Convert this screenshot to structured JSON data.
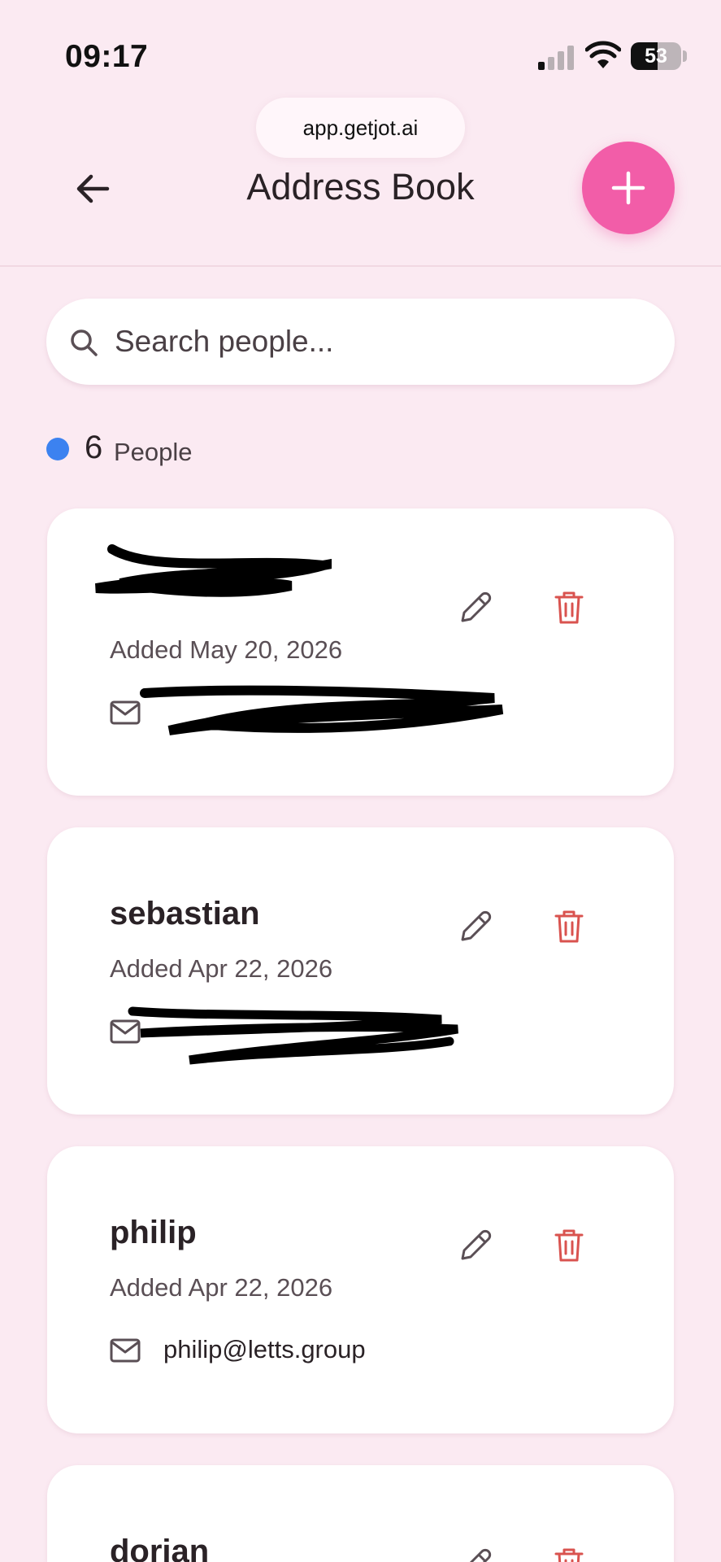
{
  "status_bar": {
    "time": "09:17",
    "battery": "53",
    "battery_level": 0.53
  },
  "browser": {
    "url": "app.getjot.ai"
  },
  "header": {
    "title": "Address Book"
  },
  "search": {
    "placeholder": "Search people..."
  },
  "summary": {
    "count": "6",
    "label": "People"
  },
  "contacts": [
    {
      "name": "",
      "added": "Added May 20, 2026",
      "email": ""
    },
    {
      "name": "sebastian",
      "added": "Added Apr 22, 2026",
      "email": ""
    },
    {
      "name": "philip",
      "added": "Added Apr 22, 2026",
      "email": "philip@letts.group"
    },
    {
      "name": "dorian",
      "added": "",
      "email": ""
    }
  ],
  "colors": {
    "accent": "#f25da8",
    "background": "#fbeaf2",
    "count_dot": "#3c82f0",
    "delete": "#d9534f"
  },
  "icons": [
    "back-arrow-icon",
    "plus-icon",
    "search-icon",
    "mail-icon",
    "pencil-icon",
    "trash-icon"
  ]
}
